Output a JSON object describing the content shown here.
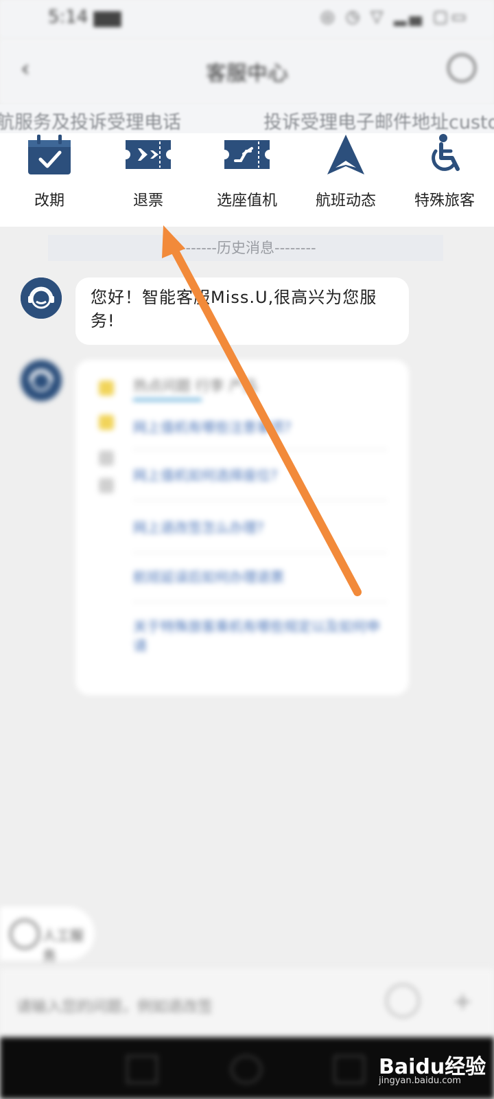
{
  "status_bar": {
    "time": "5:14 ▆▆",
    "icons": "◎ ◷ ▽ ▂▄ ▢▭"
  },
  "nav": {
    "back": "‹",
    "title": "客服中心"
  },
  "marquee": {
    "text_before": "航服务及投诉受理电话",
    "text_after": "投诉受理电子邮件地址customercare@"
  },
  "quick_menu": [
    {
      "label": "改期",
      "icon": "calendar-check-icon"
    },
    {
      "label": "退票",
      "icon": "ticket-plane-icon"
    },
    {
      "label": "选座值机",
      "icon": "boarding-pass-icon"
    },
    {
      "label": "航班动态",
      "icon": "plane-nav-icon"
    },
    {
      "label": "特殊旅客",
      "icon": "wheelchair-icon"
    }
  ],
  "history_divider": "--------历史消息--------",
  "greeting": {
    "text": "您好！智能客服Miss.U,很高兴为您服务!"
  },
  "hot_card": {
    "tabs": "热点问题  行李  产品",
    "questions": [
      "网上值机有哪些注意事项?",
      "网上值机如何选择座位?",
      "网上退改签怎么办理?",
      "航班延误后如何办理退票",
      "关于特殊旅客乘机有哪些规定以及如何申请"
    ]
  },
  "left_float": {
    "label": "人工服务"
  },
  "input_bar": {
    "placeholder": "请输入您的问题，例如退改签"
  },
  "watermark": {
    "logo": "Baidu经验",
    "site": "jingyan.baidu.com"
  },
  "colors": {
    "icon_navy": "#2c4f7c",
    "arrow_orange": "#f28a3a",
    "link_blue": "#4a74b8"
  }
}
